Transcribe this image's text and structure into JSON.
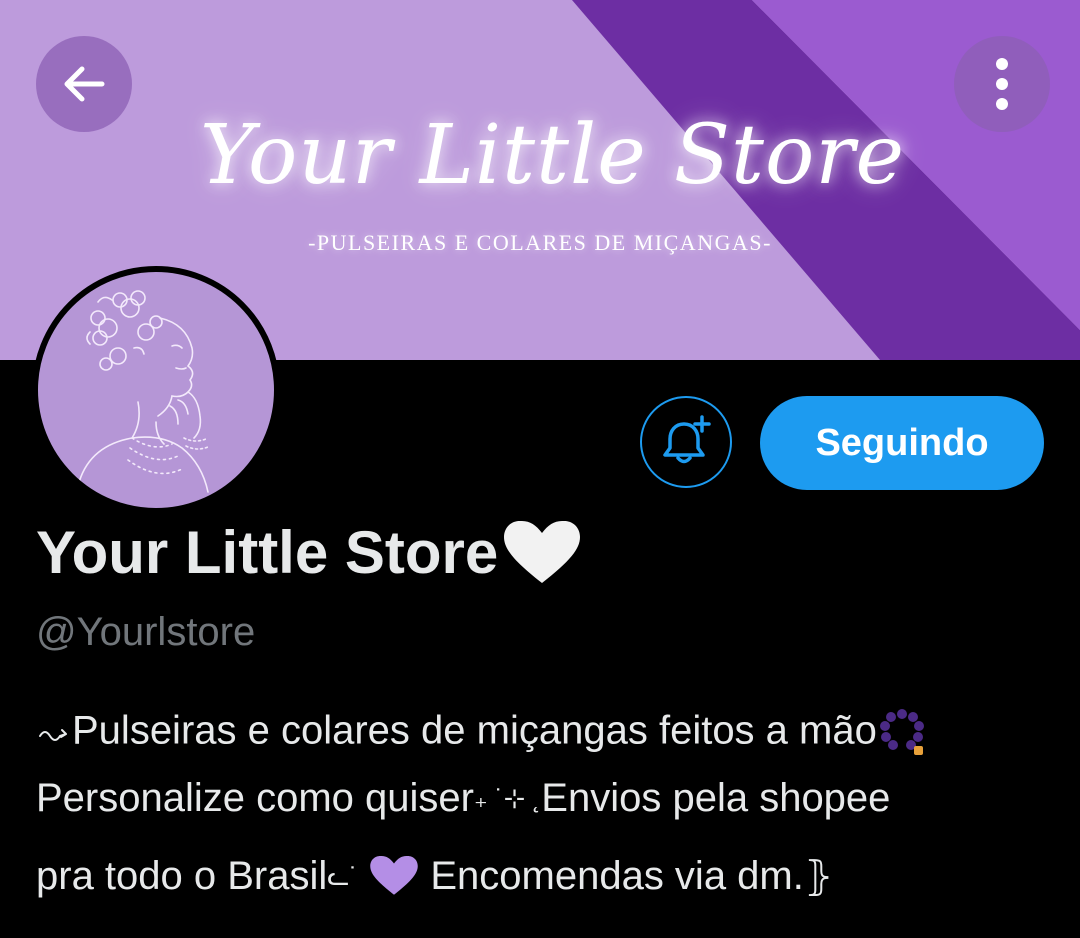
{
  "banner": {
    "title": "Your Little Store",
    "subtitle": "-PULSEIRAS E COLARES DE MIÇANGAS-",
    "colors": {
      "base": "#bd9bdc",
      "stripe_dark": "#6d2ea3",
      "stripe_light": "#9b5bd0"
    }
  },
  "toolbar": {
    "back_icon": "arrow-left-icon",
    "more_icon": "more-vertical-icon"
  },
  "profile": {
    "display_name": "Your Little Store",
    "display_name_emoji": "white-heart-icon",
    "handle": "@Yourlstore",
    "follow_button_label": "Seguindo",
    "notify_icon": "bell-plus-icon",
    "bio": {
      "line1_text": "Pulseiras e colares de miçangas feitos a mão",
      "line2_text_a": "Personalize como quiser",
      "line2_text_b": "Envios pela shopee",
      "line3_text_a": "pra todo o Brasil",
      "line3_text_b": "Encomendas via dm."
    },
    "accent_color": "#1d9bf0"
  }
}
